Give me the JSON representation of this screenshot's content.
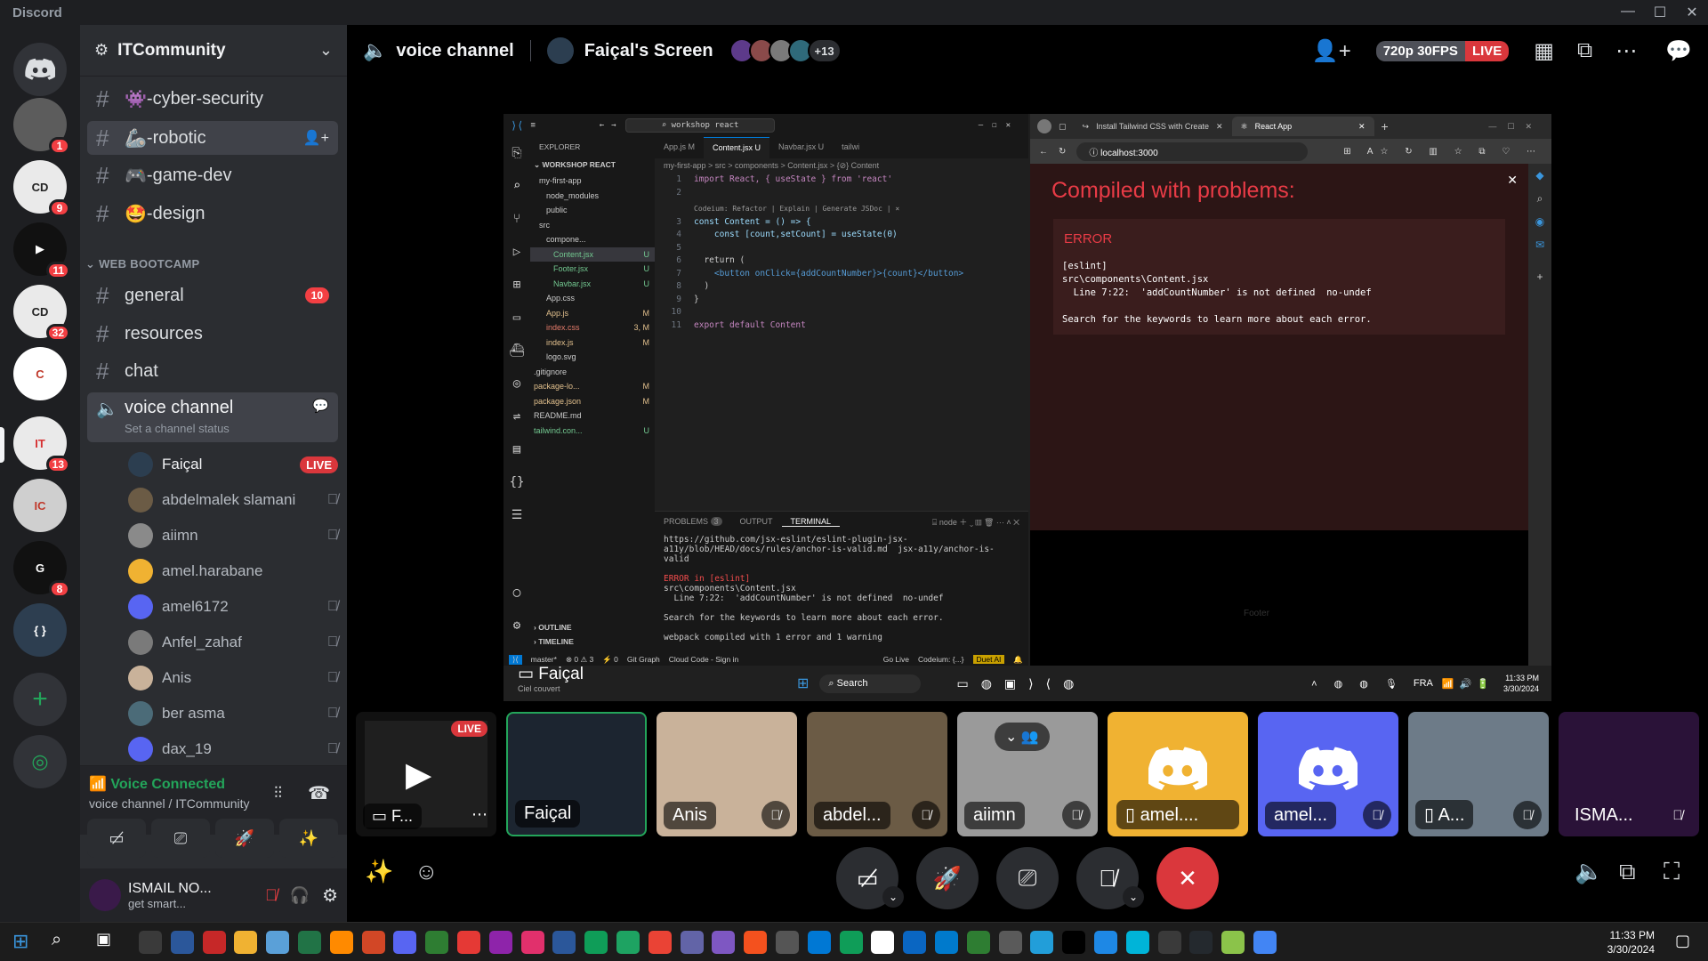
{
  "app": {
    "name": "Discord"
  },
  "guild": {
    "name": "ITCommunity"
  },
  "channels_top": [
    {
      "label": "-cyber-security",
      "emoji": "👾"
    },
    {
      "label": "-robotic",
      "emoji": "🦾"
    },
    {
      "label": "-game-dev",
      "emoji": "🎮"
    },
    {
      "label": "-design",
      "emoji": "🤩"
    }
  ],
  "category": {
    "label": "WEB BOOTCAMP"
  },
  "channels_web": [
    {
      "label": "general",
      "count": "10"
    },
    {
      "label": "resources",
      "count": ""
    },
    {
      "label": "chat",
      "count": ""
    }
  ],
  "voice_channel": {
    "label": "voice channel",
    "status": "Set a channel status"
  },
  "voice_members": [
    {
      "name": "Faiçal",
      "live": "LIVE"
    },
    {
      "name": "abdelmalek slamani"
    },
    {
      "name": "aiimn"
    },
    {
      "name": "amel.harabane"
    },
    {
      "name": "amel6172"
    },
    {
      "name": "Anfel_zahaf"
    },
    {
      "name": "Anis"
    },
    {
      "name": "ber asma"
    },
    {
      "name": "dax_19"
    }
  ],
  "server_badges": [
    "1",
    "9",
    "11",
    "32",
    "13",
    "8"
  ],
  "voice_status": {
    "title": "Voice Connected",
    "sub": "voice channel / ITCommunity"
  },
  "user": {
    "name": "ISMAIL NO...",
    "status": "get smart..."
  },
  "stage": {
    "channel": "voice channel",
    "screen_title": "Faiçal's Screen",
    "extra_viewers": "+13",
    "quality": "720p 30FPS",
    "live": "LIVE",
    "presenter_label": "Faiçal",
    "presenter_sub": "Ciel couvert"
  },
  "vscode": {
    "search": "workshop react",
    "explorer_title": "EXPLORER",
    "workspace": "WORKSHOP REACT",
    "tree": [
      "my-first-app",
      "node_modules",
      "public",
      "src",
      "compone...",
      "Content.jsx",
      "Footer.jsx",
      "Navbar.jsx",
      "App.css",
      "App.js",
      "index.css",
      "index.js",
      "logo.svg",
      ".gitignore",
      "package-lo...",
      "package.json",
      "README.md",
      "tailwind.con..."
    ],
    "tree_flags": [
      "",
      "",
      "",
      "",
      "",
      "U",
      "U",
      "U",
      "",
      "M",
      "3, M",
      "M",
      "",
      "",
      "M",
      "M",
      "",
      "U"
    ],
    "tabs": [
      "App.js M",
      "Content.jsx U",
      "Navbar.jsx U",
      "tailwi"
    ],
    "breadcrumb": "my-first-app > src > components > Content.jsx > {⊘} Content",
    "codelens": "Codeium: Refactor | Explain | Generate JSDoc | ×",
    "code": [
      "import React, { useState } from 'react'",
      "",
      "const Content = () => {",
      "    const [count,setCount] = useState(0)",
      "",
      "  return (",
      "    <button onClick={addCountNumber}>{count}</button>",
      "  )",
      "}",
      "",
      "export default Content"
    ],
    "panel_tabs": [
      "PROBLEMS",
      "OUTPUT",
      "TERMINAL"
    ],
    "problems_count": "3",
    "terminal_shell": "node",
    "terminal": [
      "https://github.com/jsx-eslint/eslint-plugin-jsx-a11y/blob/HEAD/docs/rules/anchor-is-valid.md  jsx-a11y/anchor-is-valid",
      "",
      "ERROR in [eslint]",
      "src\\components\\Content.jsx",
      "  Line 7:22:  'addCountNumber' is not defined  no-undef",
      "",
      "Search for the keywords to learn more about each error.",
      "",
      "webpack compiled with 1 error and 1 warning"
    ],
    "outline": "OUTLINE",
    "timeline": "TIMELINE",
    "status": [
      "master*",
      "⊗ 0 ⚠ 3",
      "⚡ 0",
      "Git Graph",
      "Cloud Code - Sign in",
      "Go Live",
      "Codeium: {...}",
      "Duet AI"
    ]
  },
  "browser": {
    "tabs": [
      "Install Tailwind CSS with Create",
      "React App"
    ],
    "url": "localhost:3000",
    "overlay_title": "Compiled with problems:",
    "error_title": "ERROR",
    "error_lines": [
      "[eslint]",
      "src\\components\\Content.jsx",
      "  Line 7:22:  'addCountNumber' is not defined  no-undef",
      "",
      "Search for the keywords to learn more about each error."
    ],
    "footer_text": "Footer"
  },
  "shared_taskbar": {
    "search": "Search",
    "lang": "FRA",
    "time": "11:33 PM",
    "date": "3/30/2024"
  },
  "tiles": [
    {
      "name": "F...",
      "kind": "screen",
      "live": "LIVE"
    },
    {
      "name": "Faiçal",
      "kind": "photo",
      "color": "#2c3e50"
    },
    {
      "name": "Anis",
      "kind": "photo",
      "color": "#c9b29a"
    },
    {
      "name": "abdel...",
      "kind": "photo",
      "color": "#6b5b45"
    },
    {
      "name": "aiimn",
      "kind": "photo",
      "color": "#8a8a8a"
    },
    {
      "name": "amel....",
      "kind": "discord",
      "color": "#f0b232"
    },
    {
      "name": "amel...",
      "kind": "discord",
      "color": "#5865f2"
    },
    {
      "name": "A...",
      "kind": "photo",
      "color": "#6d7b88"
    },
    {
      "name": "ISMA...",
      "kind": "photo",
      "color": "#3a1a4a"
    }
  ],
  "taskbar": {
    "time": "11:33 PM",
    "date": "3/30/2024"
  },
  "colors": {
    "accent": "#5865f2",
    "danger": "#da373c",
    "green": "#23a55a",
    "bg": "#1e1f22"
  }
}
